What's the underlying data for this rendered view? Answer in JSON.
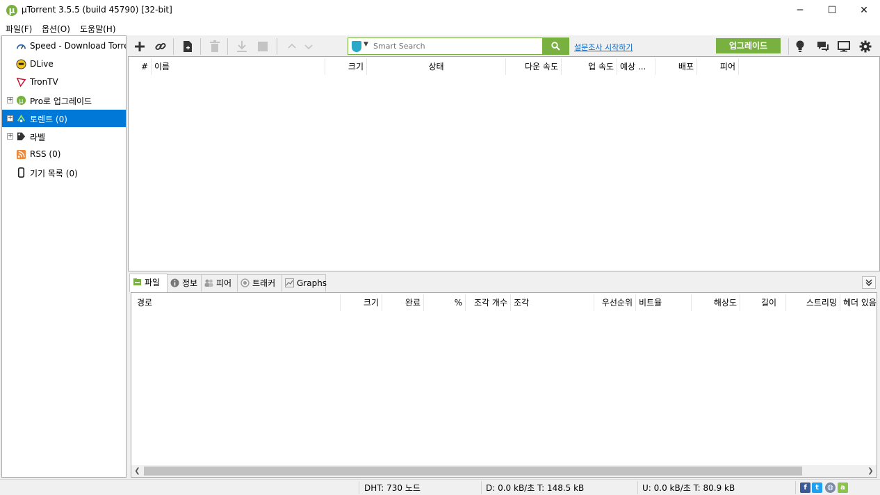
{
  "window": {
    "title": "µTorrent 3.5.5  (build 45790) [32-bit]",
    "minimize": "─",
    "maximize": "☐",
    "close": "✕"
  },
  "menu": [
    "파일(F)",
    "옵션(O)",
    "도움말(H)"
  ],
  "sidebar": {
    "items": [
      {
        "label": "Speed - Download Torrent",
        "icon": "speedometer-icon"
      },
      {
        "label": "DLive",
        "icon": "dlive-icon"
      },
      {
        "label": "TronTV",
        "icon": "trontv-icon"
      },
      {
        "label": "Pro로 업그레이드",
        "icon": "utorrent-icon"
      },
      {
        "label": "토렌트 (0)",
        "icon": "torrents-icon"
      },
      {
        "label": "라벨",
        "icon": "tag-icon"
      },
      {
        "label": "RSS (0)",
        "icon": "rss-icon"
      },
      {
        "label": "기기 목록 (0)",
        "icon": "device-icon"
      }
    ]
  },
  "search": {
    "placeholder": "Smart Search",
    "go": "🔍"
  },
  "survey_link": "설문조사 시작하기",
  "upgrade_button": "업그레이드",
  "torrent_columns": [
    "#",
    "이름",
    "크기",
    "상태",
    "다운 속도",
    "업 속도",
    "예상 ...",
    "배포",
    "피어"
  ],
  "detail_tabs": [
    "파일",
    "정보",
    "피어",
    "트래커",
    "Graphs"
  ],
  "file_columns": [
    "경로",
    "크기",
    "완료",
    "%",
    "조각 개수",
    "조각",
    "우선순위",
    "비트율",
    "해상도",
    "길이",
    "스트리밍",
    "헤더 있음"
  ],
  "status": {
    "dht": "DHT: 730 노드",
    "download": "D: 0.0 kB/초 T: 148.5 kB",
    "upload": "U: 0.0 kB/초 T: 80.9 kB"
  },
  "colors": {
    "brand_green": "#78b13f",
    "selection_blue": "#0078d7"
  }
}
